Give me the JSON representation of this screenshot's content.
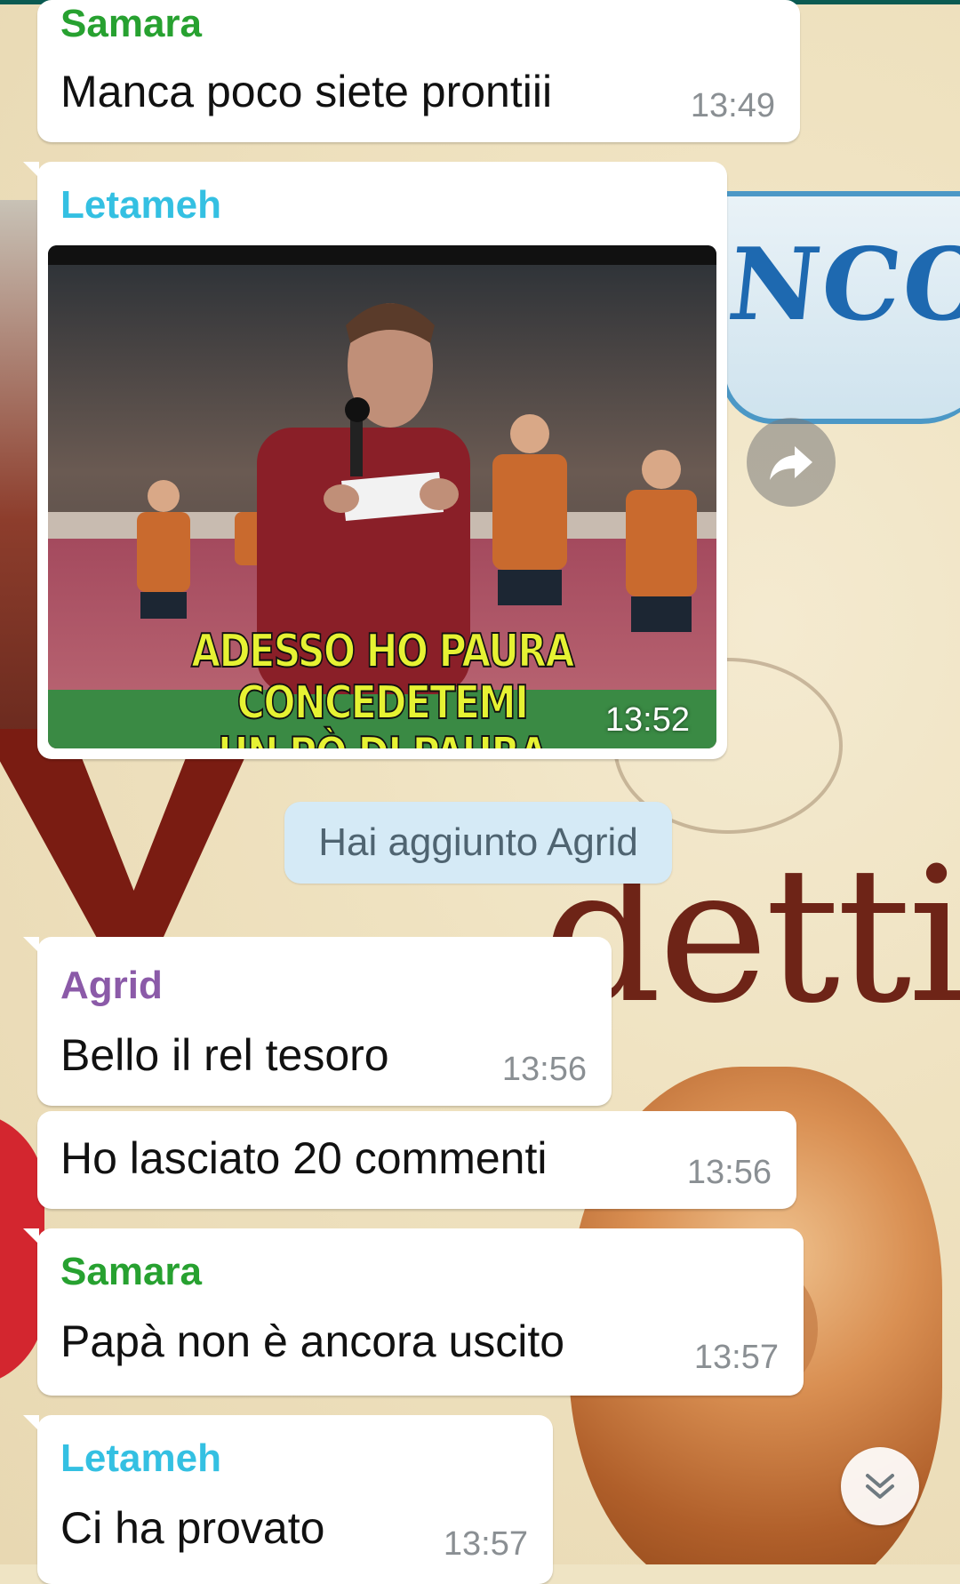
{
  "chat": {
    "messages": [
      {
        "sender": "Samara",
        "sender_color": "#27a130",
        "text": "Manca poco siete prontiii",
        "time": "13:49"
      },
      {
        "sender": "Letameh",
        "sender_color": "#34c0e2",
        "type": "image",
        "image_caption_line1": "ADESSO HO PAURA CONCEDETEMI",
        "image_caption_line2": "UN PÒ DI PAURA",
        "time": "13:52"
      },
      {
        "type": "system",
        "text": "Hai aggiunto Agrid"
      },
      {
        "sender": "Agrid",
        "sender_color": "#8b5aa8",
        "text": "Bello il rel tesoro",
        "time": "13:56"
      },
      {
        "text": "Ho lasciato 20 commenti",
        "time": "13:56"
      },
      {
        "sender": "Samara",
        "sender_color": "#27a130",
        "text": "Papà non è ancora uscito",
        "time": "13:57"
      },
      {
        "sender": "Letameh",
        "sender_color": "#34c0e2",
        "text": "Ci ha provato",
        "time": "13:57"
      }
    ]
  },
  "icons": {
    "forward": "share-forward-icon",
    "scroll_down": "double-chevron-down-icon"
  },
  "colors": {
    "bubble": "#ffffff",
    "system_pill": "#d5eaf6",
    "caption_text": "#e6f233"
  }
}
